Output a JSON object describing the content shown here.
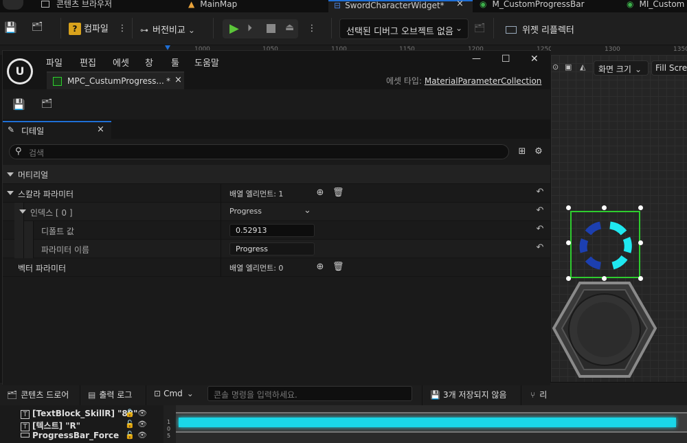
{
  "colors": {
    "window_bg": "#151515",
    "panel_bg": "#1a1a1a",
    "accent_blue": "#1f6fd6",
    "accent_green": "#2fd12f",
    "play_green": "#5cc53a",
    "selection_green": "#2ecc2e",
    "ring_cyan": "#1fe8f0",
    "ring_blue": "#1c3fb0"
  },
  "bg_tabs": [
    {
      "label": "콘텐츠 브라우저",
      "icon": "folder-icon"
    },
    {
      "label": "MainMap",
      "icon": "level-icon"
    },
    {
      "label": "SwordCharacterWidget*",
      "icon": "widget-icon",
      "close": "×"
    },
    {
      "label": "M_CustomProgressBar",
      "icon": "material-icon"
    },
    {
      "label": "MI_Custom",
      "icon": "material-icon"
    }
  ],
  "bg_toolbar": {
    "compile_label": "컴파일",
    "diff_label": "버전비교",
    "debug_object_label": "선택된 디버그 오브젝트 없음",
    "widget_reflector_label": "위젯 리플렉터"
  },
  "ruler": {
    "marks": [
      "1000",
      "1050",
      "1100",
      "1150",
      "1200",
      "1250"
    ]
  },
  "designer": {
    "ruler_marks": [
      "1300",
      "1350"
    ],
    "screen_size_label": "화면 크기",
    "fill_screen_label": "Fill Scree"
  },
  "window": {
    "menus": [
      "파일",
      "편집",
      "에셋",
      "창",
      "툴",
      "도움말"
    ],
    "doc_tab_label": "MPC_CustumProgress...",
    "doc_tab_modified": "*",
    "doc_tab_close": "×",
    "asset_type_label": "에셋 타입:",
    "asset_type_value": "MaterialParameterCollection",
    "controls": {
      "minimize": "—",
      "maximize": "☐",
      "close": "✕"
    }
  },
  "details": {
    "tab_label": "디테일",
    "tab_close": "×",
    "search_placeholder": "검색",
    "section_label": "머티리얼",
    "rows": {
      "scalar_params": {
        "label": "스칼라 파라미터",
        "value": "배열 엘리먼트: 1"
      },
      "index": {
        "label": "인덱스 [ 0 ]",
        "value": "Progress"
      },
      "default_value": {
        "label": "디폴트 값",
        "value": "0.52913"
      },
      "param_name": {
        "label": "파라미터 이름",
        "value": "Progress"
      },
      "vector_params": {
        "label": "벡터 파라미터",
        "value": "배열 엘리먼트: 0"
      }
    }
  },
  "bottom_bar": {
    "content_drawer": "콘텐츠 드로어",
    "output_log": "출력 로그",
    "cmd": "Cmd",
    "console_placeholder": "콘솔 명령을 입력하세요.",
    "unsaved": "3개 저장되지 않음",
    "source_control": "리"
  },
  "hierarchy": {
    "items": [
      {
        "label": "[TextBlock_SkillR] \"88\"",
        "icon": "text-icon"
      },
      {
        "label": "[텍스트] \"R\"",
        "icon": "text-icon"
      },
      {
        "label": "ProgressBar_Force",
        "icon": "progressbar-icon"
      }
    ],
    "ruler_ticks": [
      "1",
      "0",
      "5"
    ]
  }
}
